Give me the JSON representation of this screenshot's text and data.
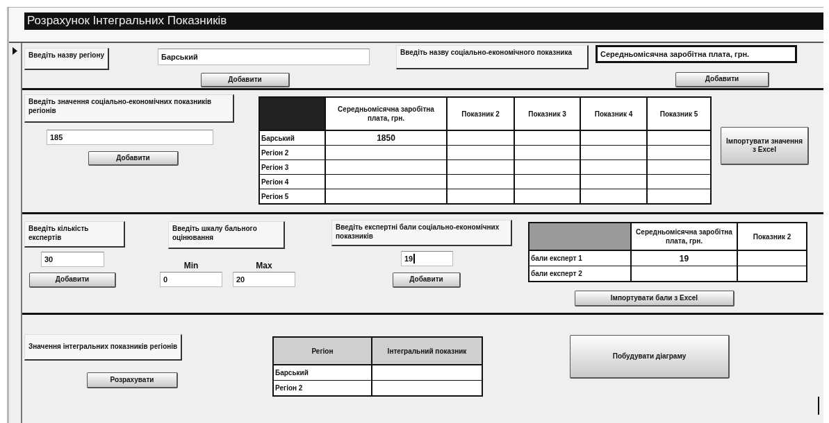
{
  "window": {
    "title": "Розрахунок Інтегральних Показників"
  },
  "region_entry": {
    "label": "Введіть назву регіону",
    "field": {
      "value": "Барський",
      "outlined": false
    },
    "button": "Добавити"
  },
  "indicator_entry": {
    "label": "Введіть назву соціально-економічного показника",
    "field": {
      "value": "Середньомісячна заробітна плата, грн.",
      "outlined": true
    },
    "button": "Добавити"
  },
  "values_entry": {
    "label": "Введіть значення соціально-економічних показників регіонів",
    "field": {
      "value": "185",
      "outlined": false
    },
    "button": "Добавити"
  },
  "values_table": {
    "dark_corner": true,
    "columns": [
      "Середньомісячна заробітна плата, грн.",
      "Показник 2",
      "Показник 3",
      "Показник 4",
      "Показник 5"
    ],
    "rows": [
      {
        "label": "Барський",
        "values": [
          "1850"
        ]
      },
      {
        "label": "Регіон 2"
      },
      {
        "label": "Регіон 3"
      },
      {
        "label": "Регіон 4"
      },
      {
        "label": "Регіон 5"
      }
    ]
  },
  "import_values_button": "Імпортувати значення з Excel",
  "experts_entry": {
    "label": "Введіть кількість експертів",
    "field": {
      "value": "30",
      "outlined": false
    },
    "button": "Добавити"
  },
  "scale_entry": {
    "label": "Введіть шкалу бального оцінювання",
    "min": {
      "label": "Min",
      "value": "0"
    },
    "max": {
      "label": "Max",
      "value": "20"
    }
  },
  "scores_entry": {
    "label": "Введіть експертні бали соціально-економічних показників",
    "field": {
      "value": "19",
      "outlined": false,
      "caret": true
    },
    "button": "Добавити"
  },
  "scores_table": {
    "dark_corner": false,
    "columns": [
      "Середньомісячна заробітна плата, грн.",
      "Показник 2"
    ],
    "rows": [
      {
        "label": "бали експерт 1",
        "values": [
          "19"
        ]
      },
      {
        "label": "бали експерт 2"
      }
    ]
  },
  "import_scores_button": "Імпортувати бали з Excel",
  "results_label": "Значення інтегральних показників регіонів",
  "calculate_button": "Розрахувати",
  "results_table": {
    "header_shaded": true,
    "columns": [
      "Регіон",
      "Інтегральний показник"
    ],
    "rows": [
      {
        "label": "Барський"
      },
      {
        "label": "Регіон 2"
      }
    ]
  },
  "chart_button": "Побудувати діаграму"
}
